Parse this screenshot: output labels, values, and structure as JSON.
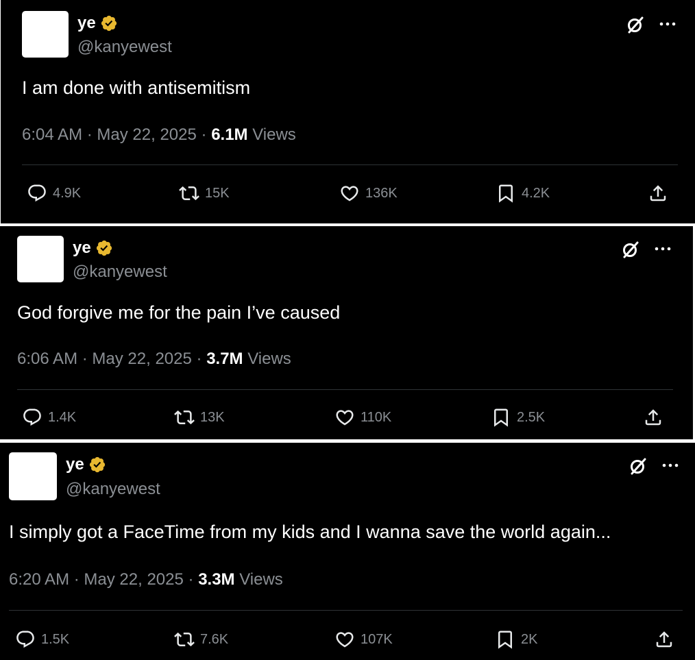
{
  "tweets": [
    {
      "name": "ye",
      "handle": "@kanyewest",
      "text": "I am done with antisemitism",
      "time": "6:04 AM",
      "date": "May 22, 2025",
      "views_count": "6.1M",
      "views_label": "Views",
      "replies": "4.9K",
      "reposts": "15K",
      "likes": "136K",
      "bookmarks": "4.2K"
    },
    {
      "name": "ye",
      "handle": "@kanyewest",
      "text": "God forgive me for the pain I’ve caused",
      "time": "6:06 AM",
      "date": "May 22, 2025",
      "views_count": "3.7M",
      "views_label": "Views",
      "replies": "1.4K",
      "reposts": "13K",
      "likes": "110K",
      "bookmarks": "2.5K"
    },
    {
      "name": "ye",
      "handle": "@kanyewest",
      "text": "I simply got a FaceTime from my kids and I wanna save the world again...",
      "time": "6:20 AM",
      "date": "May 22, 2025",
      "views_count": "3.3M",
      "views_label": "Views",
      "replies": "1.5K",
      "reposts": "7.6K",
      "likes": "107K",
      "bookmarks": "2K"
    }
  ],
  "meta_separator": "·",
  "colors": {
    "background": "#000000",
    "text": "#ffffff",
    "muted": "#8b8f94",
    "verified_badge": "#e8b830",
    "divider": "#2f3336"
  },
  "icons": [
    "verified-badge-icon",
    "grok-icon",
    "more-icon",
    "reply-icon",
    "repost-icon",
    "like-icon",
    "bookmark-icon",
    "share-icon"
  ]
}
